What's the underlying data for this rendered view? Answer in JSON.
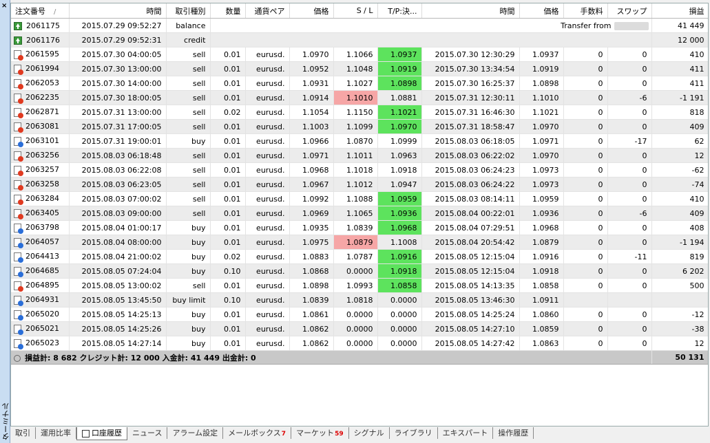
{
  "side": {
    "close": "×",
    "label": "ターミナル"
  },
  "headers": [
    "注文番号",
    "時間",
    "取引種別",
    "数量",
    "通貨ペア",
    "価格",
    "S / L",
    "T/P:決...",
    "時間",
    "価格",
    "手数料",
    "スワップ",
    "損益"
  ],
  "sort_mark": "/",
  "special_rows": [
    {
      "id": "2061175",
      "time": "2015.07.29 09:52:27",
      "type": "balance",
      "comment": "Transfer from",
      "profit": "41 449"
    },
    {
      "id": "2061176",
      "time": "2015.07.29 09:52:31",
      "type": "credit",
      "comment": "",
      "profit": "12 000"
    }
  ],
  "rows": [
    {
      "id": "2061595",
      "time": "2015.07.30 04:00:05",
      "type": "sell",
      "vol": "0.01",
      "sym": "eurusd.",
      "price": "1.0970",
      "sl": "1.1066",
      "tp": "1.0937",
      "ctime": "2015.07.30 12:30:29",
      "cprice": "1.0937",
      "comm": "0",
      "swap": "0",
      "profit": "410",
      "hl": "tp"
    },
    {
      "id": "2061994",
      "time": "2015.07.30 13:00:00",
      "type": "sell",
      "vol": "0.01",
      "sym": "eurusd.",
      "price": "1.0952",
      "sl": "1.1048",
      "tp": "1.0919",
      "ctime": "2015.07.30 13:34:54",
      "cprice": "1.0919",
      "comm": "0",
      "swap": "0",
      "profit": "411",
      "hl": "tp"
    },
    {
      "id": "2062053",
      "time": "2015.07.30 14:00:00",
      "type": "sell",
      "vol": "0.01",
      "sym": "eurusd.",
      "price": "1.0931",
      "sl": "1.1027",
      "tp": "1.0898",
      "ctime": "2015.07.30 16:25:37",
      "cprice": "1.0898",
      "comm": "0",
      "swap": "0",
      "profit": "411",
      "hl": "tp"
    },
    {
      "id": "2062235",
      "time": "2015.07.30 18:00:05",
      "type": "sell",
      "vol": "0.01",
      "sym": "eurusd.",
      "price": "1.0914",
      "sl": "1.1010",
      "tp": "1.0881",
      "ctime": "2015.07.31 12:30:11",
      "cprice": "1.1010",
      "comm": "0",
      "swap": "-6",
      "profit": "-1 191",
      "hl": "sl"
    },
    {
      "id": "2062871",
      "time": "2015.07.31 13:00:00",
      "type": "sell",
      "vol": "0.02",
      "sym": "eurusd.",
      "price": "1.1054",
      "sl": "1.1150",
      "tp": "1.1021",
      "ctime": "2015.07.31 16:46:30",
      "cprice": "1.1021",
      "comm": "0",
      "swap": "0",
      "profit": "818",
      "hl": "tp"
    },
    {
      "id": "2063081",
      "time": "2015.07.31 17:00:05",
      "type": "sell",
      "vol": "0.01",
      "sym": "eurusd.",
      "price": "1.1003",
      "sl": "1.1099",
      "tp": "1.0970",
      "ctime": "2015.07.31 18:58:47",
      "cprice": "1.0970",
      "comm": "0",
      "swap": "0",
      "profit": "409",
      "hl": "tp"
    },
    {
      "id": "2063101",
      "time": "2015.07.31 19:00:01",
      "type": "buy",
      "vol": "0.01",
      "sym": "eurusd.",
      "price": "1.0966",
      "sl": "1.0870",
      "tp": "1.0999",
      "ctime": "2015.08.03 06:18:05",
      "cprice": "1.0971",
      "comm": "0",
      "swap": "-17",
      "profit": "62",
      "hl": ""
    },
    {
      "id": "2063256",
      "time": "2015.08.03 06:18:48",
      "type": "sell",
      "vol": "0.01",
      "sym": "eurusd.",
      "price": "1.0971",
      "sl": "1.1011",
      "tp": "1.0963",
      "ctime": "2015.08.03 06:22:02",
      "cprice": "1.0970",
      "comm": "0",
      "swap": "0",
      "profit": "12",
      "hl": ""
    },
    {
      "id": "2063257",
      "time": "2015.08.03 06:22:08",
      "type": "sell",
      "vol": "0.01",
      "sym": "eurusd.",
      "price": "1.0968",
      "sl": "1.1018",
      "tp": "1.0918",
      "ctime": "2015.08.03 06:24:23",
      "cprice": "1.0973",
      "comm": "0",
      "swap": "0",
      "profit": "-62",
      "hl": ""
    },
    {
      "id": "2063258",
      "time": "2015.08.03 06:23:05",
      "type": "sell",
      "vol": "0.01",
      "sym": "eurusd.",
      "price": "1.0967",
      "sl": "1.1012",
      "tp": "1.0947",
      "ctime": "2015.08.03 06:24:22",
      "cprice": "1.0973",
      "comm": "0",
      "swap": "0",
      "profit": "-74",
      "hl": ""
    },
    {
      "id": "2063284",
      "time": "2015.08.03 07:00:02",
      "type": "sell",
      "vol": "0.01",
      "sym": "eurusd.",
      "price": "1.0992",
      "sl": "1.1088",
      "tp": "1.0959",
      "ctime": "2015.08.03 08:14:11",
      "cprice": "1.0959",
      "comm": "0",
      "swap": "0",
      "profit": "410",
      "hl": "tp"
    },
    {
      "id": "2063405",
      "time": "2015.08.03 09:00:00",
      "type": "sell",
      "vol": "0.01",
      "sym": "eurusd.",
      "price": "1.0969",
      "sl": "1.1065",
      "tp": "1.0936",
      "ctime": "2015.08.04 00:22:01",
      "cprice": "1.0936",
      "comm": "0",
      "swap": "-6",
      "profit": "409",
      "hl": "tp"
    },
    {
      "id": "2063798",
      "time": "2015.08.04 01:00:17",
      "type": "buy",
      "vol": "0.01",
      "sym": "eurusd.",
      "price": "1.0935",
      "sl": "1.0839",
      "tp": "1.0968",
      "ctime": "2015.08.04 07:29:51",
      "cprice": "1.0968",
      "comm": "0",
      "swap": "0",
      "profit": "408",
      "hl": "tp"
    },
    {
      "id": "2064057",
      "time": "2015.08.04 08:00:00",
      "type": "buy",
      "vol": "0.01",
      "sym": "eurusd.",
      "price": "1.0975",
      "sl": "1.0879",
      "tp": "1.1008",
      "ctime": "2015.08.04 20:54:42",
      "cprice": "1.0879",
      "comm": "0",
      "swap": "0",
      "profit": "-1 194",
      "hl": "sl"
    },
    {
      "id": "2064413",
      "time": "2015.08.04 21:00:02",
      "type": "buy",
      "vol": "0.02",
      "sym": "eurusd.",
      "price": "1.0883",
      "sl": "1.0787",
      "tp": "1.0916",
      "ctime": "2015.08.05 12:15:04",
      "cprice": "1.0916",
      "comm": "0",
      "swap": "-11",
      "profit": "819",
      "hl": "tp"
    },
    {
      "id": "2064685",
      "time": "2015.08.05 07:24:04",
      "type": "buy",
      "vol": "0.10",
      "sym": "eurusd.",
      "price": "1.0868",
      "sl": "0.0000",
      "tp": "1.0918",
      "ctime": "2015.08.05 12:15:04",
      "cprice": "1.0918",
      "comm": "0",
      "swap": "0",
      "profit": "6 202",
      "hl": "tp"
    },
    {
      "id": "2064895",
      "time": "2015.08.05 13:00:02",
      "type": "sell",
      "vol": "0.01",
      "sym": "eurusd.",
      "price": "1.0898",
      "sl": "1.0993",
      "tp": "1.0858",
      "ctime": "2015.08.05 14:13:35",
      "cprice": "1.0858",
      "comm": "0",
      "swap": "0",
      "profit": "500",
      "hl": "tp"
    },
    {
      "id": "2064931",
      "time": "2015.08.05 13:45:50",
      "type": "buy limit",
      "vol": "0.10",
      "sym": "eurusd.",
      "price": "1.0839",
      "sl": "1.0818",
      "tp": "0.0000",
      "ctime": "2015.08.05 13:46:30",
      "cprice": "1.0911",
      "comm": "",
      "swap": "",
      "profit": "",
      "hl": ""
    },
    {
      "id": "2065020",
      "time": "2015.08.05 14:25:13",
      "type": "buy",
      "vol": "0.01",
      "sym": "eurusd.",
      "price": "1.0861",
      "sl": "0.0000",
      "tp": "0.0000",
      "ctime": "2015.08.05 14:25:24",
      "cprice": "1.0860",
      "comm": "0",
      "swap": "0",
      "profit": "-12",
      "hl": ""
    },
    {
      "id": "2065021",
      "time": "2015.08.05 14:25:26",
      "type": "buy",
      "vol": "0.01",
      "sym": "eurusd.",
      "price": "1.0862",
      "sl": "0.0000",
      "tp": "0.0000",
      "ctime": "2015.08.05 14:27:10",
      "cprice": "1.0859",
      "comm": "0",
      "swap": "0",
      "profit": "-38",
      "hl": ""
    },
    {
      "id": "2065023",
      "time": "2015.08.05 14:27:14",
      "type": "buy",
      "vol": "0.01",
      "sym": "eurusd.",
      "price": "1.0862",
      "sl": "0.0000",
      "tp": "0.0000",
      "ctime": "2015.08.05 14:27:42",
      "cprice": "1.0863",
      "comm": "0",
      "swap": "0",
      "profit": "12",
      "hl": ""
    }
  ],
  "total": {
    "summary": "損益計: 8 682  クレジット計: 12 000  入金計: 41 449  出金計: 0",
    "profit": "50 131"
  },
  "tabs": [
    {
      "label": "取引",
      "badge": ""
    },
    {
      "label": "運用比率",
      "badge": ""
    },
    {
      "label": "口座履歴",
      "badge": "",
      "active": true
    },
    {
      "label": "ニュース",
      "badge": ""
    },
    {
      "label": "アラーム設定",
      "badge": ""
    },
    {
      "label": "メールボックス",
      "badge": "7"
    },
    {
      "label": "マーケット",
      "badge": "59"
    },
    {
      "label": "シグナル",
      "badge": ""
    },
    {
      "label": "ライブラリ",
      "badge": ""
    },
    {
      "label": "エキスパート",
      "badge": ""
    },
    {
      "label": "操作履歴",
      "badge": ""
    }
  ],
  "colors": {
    "tp_highlight": "#5de35d",
    "sl_highlight": "#f6a6a6",
    "sell_icon": "#e03a20",
    "buy_icon": "#2a6ed8"
  }
}
